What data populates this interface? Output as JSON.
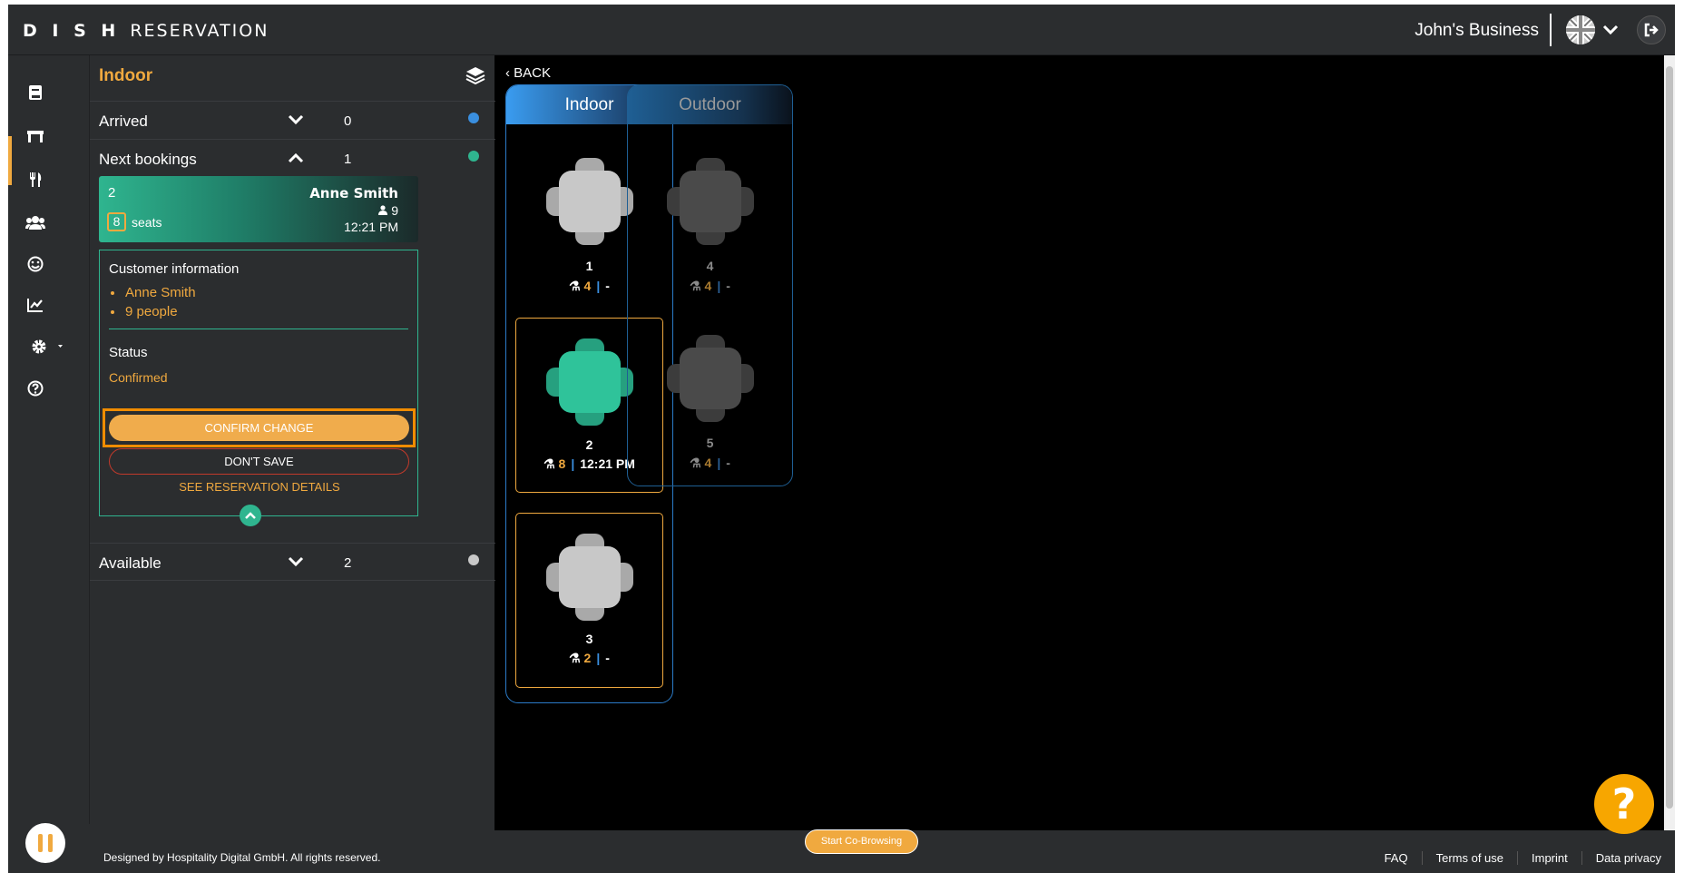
{
  "header": {
    "brand_bold": "D I S H",
    "brand_rest": "RESERVATION",
    "business": "John's Business"
  },
  "panel": {
    "title": "Indoor",
    "rows": [
      {
        "label": "Arrived",
        "count": "0",
        "color": "#3a8fe0"
      },
      {
        "label": "Next bookings",
        "count": "1",
        "color": "#2fb58f"
      },
      {
        "label": "Available",
        "count": "2",
        "color": "#c8c8c8"
      }
    ],
    "booking": {
      "table": "2",
      "name": "Anne Smith",
      "people": "9",
      "time": "12:21 PM",
      "seats_num": "8",
      "seats_label": "seats"
    },
    "customer": {
      "heading": "Customer information",
      "items": [
        "Anne Smith",
        "9 people"
      ]
    },
    "status": {
      "label": "Status",
      "value": "Confirmed"
    },
    "buttons": {
      "confirm": "CONFIRM CHANGE",
      "dont_save": "DON'T SAVE",
      "details": "SEE RESERVATION DETAILS"
    }
  },
  "floor": {
    "back": "BACK",
    "areas": [
      {
        "name": "Indoor",
        "active": true
      },
      {
        "name": "Outdoor",
        "active": false
      }
    ],
    "tables": [
      {
        "num": "1",
        "seats": "4",
        "time": "-"
      },
      {
        "num": "2",
        "seats": "8",
        "time": "12:21 PM"
      },
      {
        "num": "3",
        "seats": "2",
        "time": "-"
      },
      {
        "num": "4",
        "seats": "4",
        "time": "-"
      },
      {
        "num": "5",
        "seats": "4",
        "time": "-"
      }
    ]
  },
  "footer": {
    "copyright": "Designed by Hospitality Digital GmbH. All rights reserved.",
    "cobrowse": "Start Co-Browsing",
    "links": [
      "FAQ",
      "Terms of use",
      "Imprint",
      "Data privacy"
    ],
    "help": "?"
  },
  "colors": {
    "accent": "#f0a93f",
    "green": "#2fb58f",
    "blue": "#3a8fe0"
  },
  "icons": [
    "book-icon",
    "table-icon",
    "cutlery-icon",
    "users-icon",
    "smile-icon",
    "chart-icon",
    "gear-icon",
    "help-circle-icon",
    "layers-icon",
    "logout-icon",
    "flag-icon",
    "chevron-down-icon",
    "chevron-up-icon",
    "chair-icon",
    "person-icon",
    "pause-icon"
  ]
}
